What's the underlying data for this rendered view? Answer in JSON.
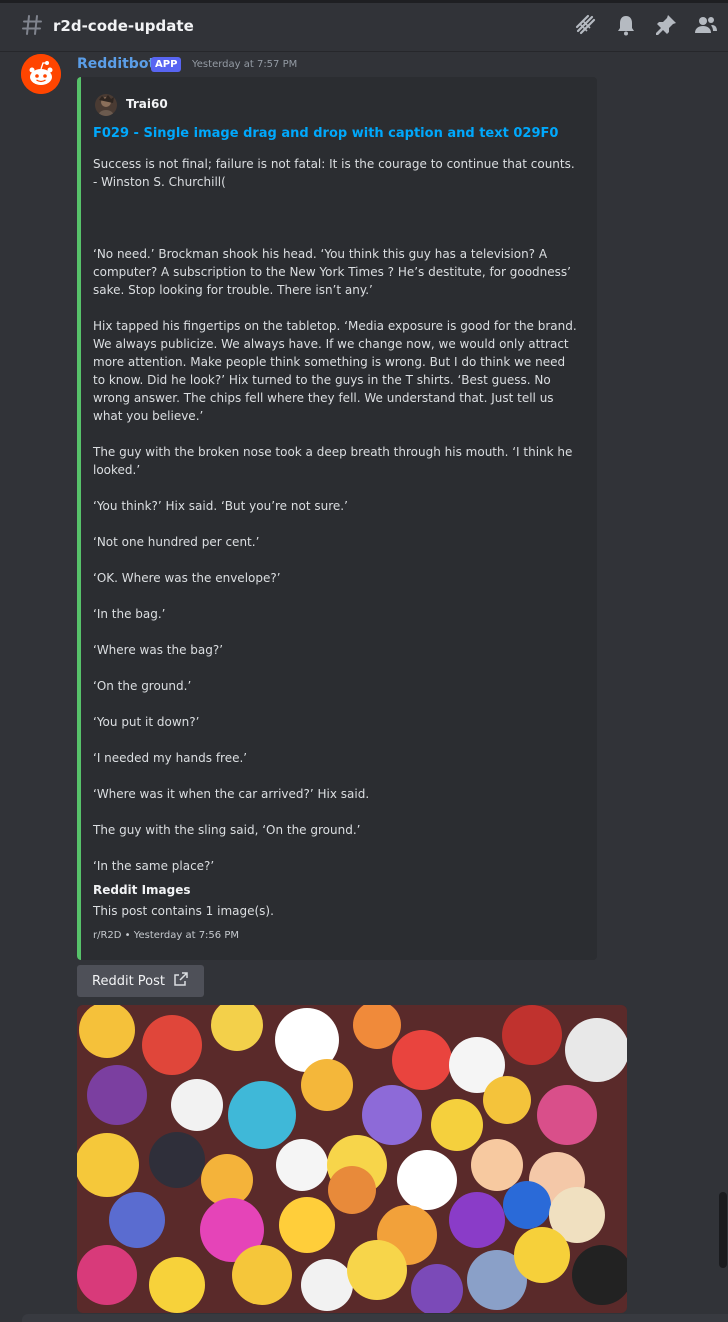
{
  "header": {
    "channel": "r2d-code-update",
    "icons": [
      "hash-icon",
      "threads-icon",
      "bell-icon",
      "pin-icon",
      "members-icon"
    ]
  },
  "message": {
    "author": "Redditbot",
    "badge": "APP",
    "timestamp": "Yesterday at 7:57 PM",
    "embed": {
      "accent_color": "#57c26a",
      "author_name": "Trai60",
      "title": "F029 - Single image drag and drop with caption and text 029F0",
      "paragraphs": [
        "Success is not final; failure is not fatal: It is the courage to continue that counts. - Winston S. Churchill(",
        "‘No need.’ Brockman shook his head. ‘You think this guy has a television? A computer? A subscription to the New York Times ? He’s destitute, for goodness’ sake. Stop looking for trouble. There isn’t any.’",
        "Hix tapped his fingertips on the tabletop. ‘Media exposure is good for the brand. We always publicize. We always have. If we change now, we would only attract more attention. Make people think something is wrong. But I do think we need to know. Did he look?’ Hix turned to the guys in the T shirts. ‘Best guess. No wrong answer. The chips fell where they fell. We understand that. Just tell us what you believe.’",
        "The guy with the broken nose took a deep breath through his mouth. ‘I think he looked.’",
        "‘You think?’ Hix said. ‘But you’re not sure.’",
        "‘Not one hundred per cent.’",
        "‘OK. Where was the envelope?’",
        "‘In the bag.’",
        "‘Where was the bag?’",
        "‘On the ground.’",
        "‘You put it down?’",
        "‘I needed my hands free.’",
        "‘Where was it when the car arrived?’ Hix said.",
        "The guy with the sling said, ‘On the ground.’",
        "‘In the same place?’"
      ],
      "field_name": "Reddit Images",
      "field_value": "This post contains 1 image(s).",
      "footer": "r/R2D • Yesterday at 7:56 PM"
    },
    "button_label": "Reddit Post"
  }
}
